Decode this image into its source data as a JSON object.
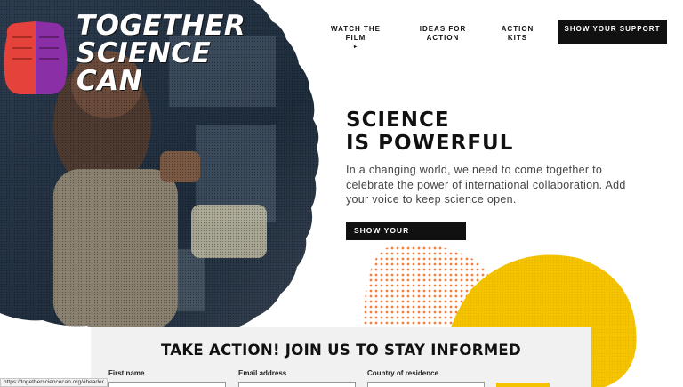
{
  "logo": {
    "line1": "TOGETHER",
    "line2": "SCIENCE",
    "line3": "CAN",
    "fist_left_color": "#e4423a",
    "fist_right_color": "#8b2fa6"
  },
  "nav": {
    "items": [
      {
        "label": "WATCH THE FILM",
        "caret": "▸"
      },
      {
        "label": "IDEAS FOR ACTION"
      },
      {
        "label": "ACTION KITS"
      }
    ],
    "cta_label": "SHOW YOUR SUPPORT"
  },
  "hero": {
    "headline_line1": "SCIENCE",
    "headline_line2": "IS POWERFUL",
    "intro": "In a changing world, we need to come together to celebrate the power of international collaboration. Add your voice to keep science open.",
    "cta_label": "SHOW YOUR SUPPORT",
    "cta_arrow": "▶"
  },
  "form": {
    "title": "TAKE ACTION! JOIN US TO STAY INFORMED",
    "fields": [
      {
        "label": "First name",
        "value": ""
      },
      {
        "label": "Email address",
        "value": ""
      },
      {
        "label": "Country of residence",
        "value": ""
      }
    ]
  },
  "status_bar": {
    "url": "https://togethersciencecan.org/#header"
  },
  "colors": {
    "accent_yellow": "#f5c400",
    "accent_orange": "#f26a1b",
    "dark": "#111111"
  }
}
